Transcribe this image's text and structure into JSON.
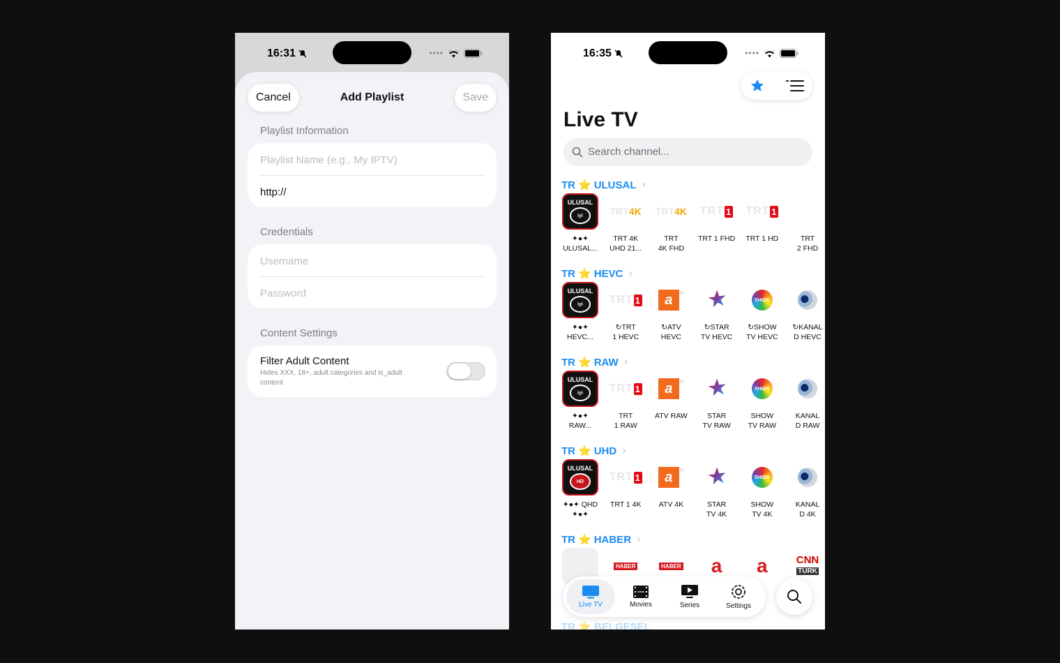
{
  "left_screen": {
    "status": {
      "time": "16:31"
    },
    "header": {
      "cancel": "Cancel",
      "title": "Add Playlist",
      "save": "Save"
    },
    "playlist_info": {
      "label": "Playlist Information",
      "name_placeholder": "Playlist Name (e.g., My IPTV)",
      "url_value": "http://"
    },
    "credentials": {
      "label": "Credentials",
      "username_placeholder": "Username",
      "password_placeholder": "Password"
    },
    "content_settings": {
      "label": "Content Settings",
      "filter_title": "Filter Adult Content",
      "filter_desc": "Hides XXX, 18+, adult categories and is_adult content",
      "filter_enabled": false
    }
  },
  "right_screen": {
    "status": {
      "time": "16:35"
    },
    "title": "Live TV",
    "search_placeholder": "Search channel...",
    "accent": "#1a8cf0",
    "sections": [
      {
        "prefix": "TR",
        "name": "ULUSAL",
        "channels": [
          {
            "logo": "ulusal",
            "label": "✦●✦\nULUSAL..."
          },
          {
            "logo": "trt4k",
            "label": "TRT 4K\nUHD 21..."
          },
          {
            "logo": "trt4k",
            "label": "TRT\n4K FHD"
          },
          {
            "logo": "trt1",
            "label": "TRT 1 FHD"
          },
          {
            "logo": "trt1",
            "label": "TRT 1 HD"
          },
          {
            "logo": "none",
            "label": "TRT\n2 FHD"
          }
        ]
      },
      {
        "prefix": "TR",
        "name": "HEVC",
        "channels": [
          {
            "logo": "ulusal",
            "label": "✦●✦\nHEVC..."
          },
          {
            "logo": "trt1",
            "label": "↻TRT\n1 HEVC"
          },
          {
            "logo": "atv",
            "label": "↻ATV\nHEVC"
          },
          {
            "logo": "star",
            "label": "↻STAR\nTV HEVC"
          },
          {
            "logo": "show",
            "label": "↻SHOW\nTV HEVC"
          },
          {
            "logo": "kanald",
            "label": "↻KANAL\nD HEVC"
          }
        ]
      },
      {
        "prefix": "TR",
        "name": "RAW",
        "channels": [
          {
            "logo": "ulusal",
            "label": "✦●✦\nRAW..."
          },
          {
            "logo": "trt1",
            "label": "TRT\n1 RAW"
          },
          {
            "logo": "atv",
            "label": "ATV RAW"
          },
          {
            "logo": "star",
            "label": "STAR\nTV  RAW"
          },
          {
            "logo": "show",
            "label": "SHOW\nTV RAW"
          },
          {
            "logo": "kanald",
            "label": "KANAL\nD RAW"
          }
        ]
      },
      {
        "prefix": "TR",
        "name": "UHD",
        "channels": [
          {
            "logo": "ulusal-hd",
            "label": "✦●✦ QHD\n✦●✦"
          },
          {
            "logo": "trt1",
            "label": "TRT 1 4K"
          },
          {
            "logo": "atv",
            "label": "ATV 4K"
          },
          {
            "logo": "star",
            "label": "STAR\nTV 4K"
          },
          {
            "logo": "show",
            "label": "SHOW\nTV 4K"
          },
          {
            "logo": "kanald",
            "label": "KANAL\nD 4K"
          }
        ]
      },
      {
        "prefix": "TR",
        "name": "HABER",
        "channels": [
          {
            "logo": "placeholder",
            "label": ""
          },
          {
            "logo": "haber",
            "label": ""
          },
          {
            "logo": "haber",
            "label": ""
          },
          {
            "logo": "ahaber",
            "label": ""
          },
          {
            "logo": "ahaber",
            "label": ""
          },
          {
            "logo": "cnn",
            "label": ""
          }
        ]
      }
    ],
    "next_section": "TR ⭐ BELGESEL",
    "tabs": [
      {
        "label": "Live TV",
        "icon": "tv-icon",
        "active": true
      },
      {
        "label": "Movies",
        "icon": "film-icon",
        "active": false
      },
      {
        "label": "Series",
        "icon": "play-icon",
        "active": false
      },
      {
        "label": "Settings",
        "icon": "gear-icon",
        "active": false
      }
    ]
  }
}
